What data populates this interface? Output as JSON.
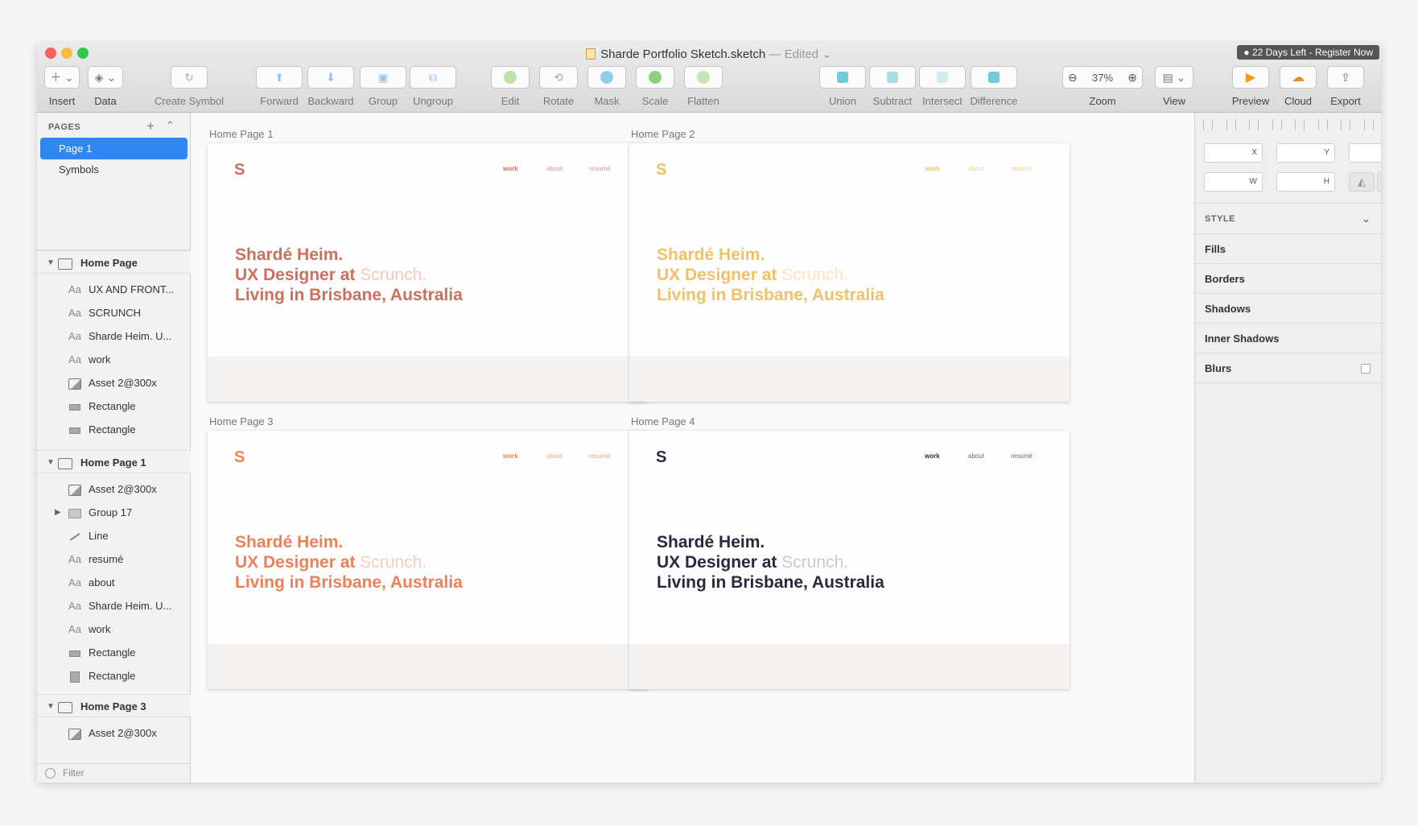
{
  "window": {
    "title": "Sharde Portfolio Sketch.sketch",
    "edited": "— Edited ⌄",
    "trial_badge": "● 22 Days Left - Register Now"
  },
  "toolbar": {
    "insert": "Insert",
    "data": "Data",
    "create_symbol": "Create Symbol",
    "forward": "Forward",
    "backward": "Backward",
    "group": "Group",
    "ungroup": "Ungroup",
    "edit": "Edit",
    "rotate": "Rotate",
    "mask": "Mask",
    "scale": "Scale",
    "flatten": "Flatten",
    "union": "Union",
    "subtract": "Subtract",
    "intersect": "Intersect",
    "difference": "Difference",
    "zoom_label": "Zoom",
    "zoom_value": "37%",
    "view": "View",
    "preview": "Preview",
    "cloud": "Cloud",
    "export": "Export"
  },
  "sidebar": {
    "pages_header": "PAGES",
    "pages": [
      "Page 1",
      "Symbols"
    ],
    "layers": [
      {
        "label": "Home Page",
        "kind": "artboard"
      },
      {
        "label": "UX AND FRONT...",
        "kind": "text"
      },
      {
        "label": "SCRUNCH",
        "kind": "text"
      },
      {
        "label": "Sharde Heim. U...",
        "kind": "text"
      },
      {
        "label": "work",
        "kind": "text"
      },
      {
        "label": "Asset 2@300x",
        "kind": "image"
      },
      {
        "label": "Rectangle",
        "kind": "rect"
      },
      {
        "label": "Rectangle",
        "kind": "rect"
      },
      {
        "label": "Home Page 1",
        "kind": "artboard"
      },
      {
        "label": "Asset 2@300x",
        "kind": "image"
      },
      {
        "label": "Group 17",
        "kind": "group"
      },
      {
        "label": "Line",
        "kind": "line"
      },
      {
        "label": "resumé",
        "kind": "text"
      },
      {
        "label": "about",
        "kind": "text"
      },
      {
        "label": "Sharde Heim. U...",
        "kind": "text"
      },
      {
        "label": "work",
        "kind": "text"
      },
      {
        "label": "Rectangle",
        "kind": "rect"
      },
      {
        "label": "Rectangle",
        "kind": "rect"
      },
      {
        "label": "Home Page 3",
        "kind": "artboard"
      },
      {
        "label": "Asset 2@300x",
        "kind": "image"
      }
    ],
    "text_glyph": "Aa",
    "filter": "Filter"
  },
  "canvas": {
    "artboards": [
      {
        "title": "Home Page 1",
        "color": "#c9705e",
        "brand_color": "#f1c9c1",
        "nav_color": "#c9705e"
      },
      {
        "title": "Home Page 2",
        "color": "#efc26a",
        "brand_color": "#f8e6c2",
        "nav_color": "#efc26a"
      },
      {
        "title": "Home Page 3",
        "color": "#e9825a",
        "brand_color": "#f6cdbd",
        "nav_color": "#e9825a"
      },
      {
        "title": "Home Page 4",
        "color": "#262b3c",
        "brand_color": "#c9cad2",
        "nav_color": "#262b3c"
      }
    ],
    "logo": "S",
    "nav": [
      "work",
      "about",
      "resumé"
    ],
    "hero": {
      "line1": "Shardé Heim.",
      "line2_prefix": "UX Designer at ",
      "line2_brand": "Scrunch.",
      "line3": "Living in Brisbane, Australia"
    }
  },
  "inspector": {
    "fields": {
      "x": "X",
      "y": "Y",
      "rotation": "°",
      "w": "W",
      "h": "H"
    },
    "style_header": "STYLE",
    "style_rows": [
      "Fills",
      "Borders",
      "Shadows",
      "Inner Shadows",
      "Blurs"
    ]
  }
}
